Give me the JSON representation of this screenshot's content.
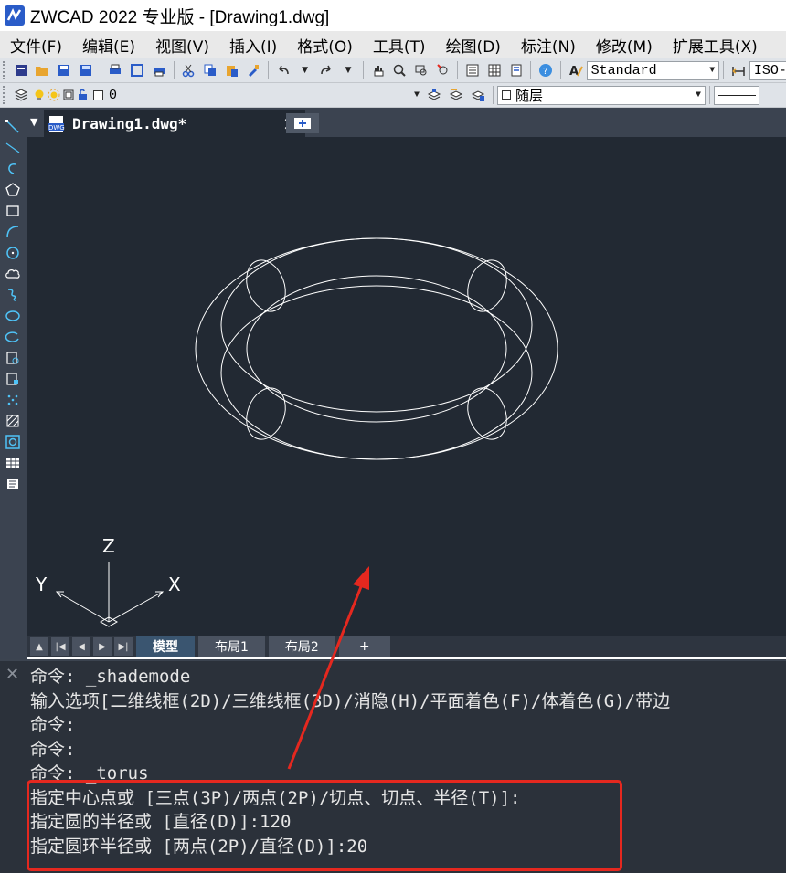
{
  "window": {
    "title": "ZWCAD 2022 专业版 - [Drawing1.dwg]"
  },
  "menu": {
    "items": [
      "文件(F)",
      "编辑(E)",
      "视图(V)",
      "插入(I)",
      "格式(O)",
      "工具(T)",
      "绘图(D)",
      "标注(N)",
      "修改(M)",
      "扩展工具(X)"
    ]
  },
  "toolbar": {
    "text_style": "Standard",
    "dim_style": "ISO-",
    "layer_value": "0",
    "color_value": "随层"
  },
  "document": {
    "tab_label": "Drawing1.dwg*"
  },
  "axes": {
    "x": "X",
    "y": "Y",
    "z": "Z"
  },
  "layouts": {
    "tabs": [
      "模型",
      "布局1",
      "布局2"
    ],
    "add_label": "+"
  },
  "command": {
    "lines": [
      "命令: _shademode",
      "输入选项[二维线框(2D)/三维线框(3D)/消隐(H)/平面着色(F)/体着色(G)/带边",
      "命令:",
      "命令:",
      "命令: _torus",
      "指定中心点或 [三点(3P)/两点(2P)/切点、切点、半径(T)]:",
      "指定圆的半径或 [直径(D)]:120",
      "指定圆环半径或 [两点(2P)/直径(D)]:20"
    ]
  },
  "colors": {
    "canvas_bg": "#222933",
    "annotation_red": "#e5281f",
    "drawing_stroke": "#ffffff"
  }
}
